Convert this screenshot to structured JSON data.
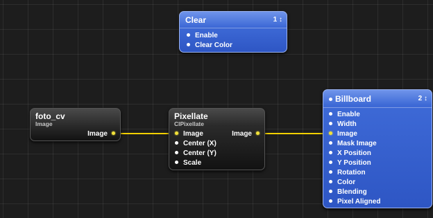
{
  "canvas": {
    "wire_color": "#f2d000",
    "port_connected_color": "#f2e23a",
    "port_color": "#ffffff"
  },
  "clear": {
    "title": "Clear",
    "badge": "1 ↕",
    "inputs": [
      "Enable",
      "Clear Color"
    ]
  },
  "foto": {
    "title": "foto_cv",
    "subtitle": "Image",
    "outputs": [
      "Image"
    ]
  },
  "pixellate": {
    "title": "Pixellate",
    "subtitle": "CIPixellate",
    "inputs": [
      "Image",
      "Center (X)",
      "Center (Y)",
      "Scale"
    ],
    "outputs": [
      "Image"
    ]
  },
  "billboard": {
    "title": "Billboard",
    "badge": "2 ↕",
    "inputs": [
      "Enable",
      "Width",
      "Image",
      "Mask Image",
      "X Position",
      "Y Position",
      "Rotation",
      "Color",
      "Blending",
      "Pixel Aligned"
    ]
  }
}
